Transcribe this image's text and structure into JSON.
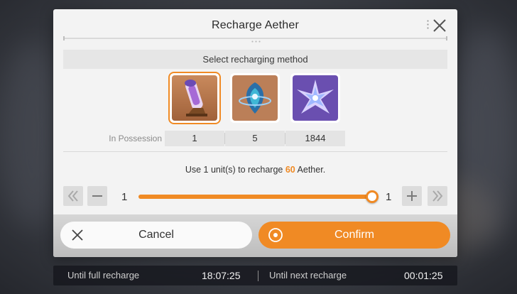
{
  "dialog": {
    "title": "Recharge Aether",
    "close_icon": "close-icon"
  },
  "method": {
    "heading": "Select recharging method",
    "items": [
      {
        "icon": "aether-vial-icon",
        "selected": true
      },
      {
        "icon": "aether-orb-icon",
        "selected": false
      },
      {
        "icon": "aether-crystal-icon",
        "selected": false
      }
    ]
  },
  "possession": {
    "label": "In Possession",
    "values": [
      "1",
      "5",
      "1844"
    ]
  },
  "recharge_info": {
    "prefix": "Use 1 unit(s) to recharge ",
    "amount": "60",
    "suffix": " Aether.",
    "amount_color": "#f08a24"
  },
  "quantity": {
    "min": "1",
    "max": "1",
    "fill_fraction": 1.0,
    "buttons": [
      "double-chevron-left-icon",
      "minus-icon",
      "plus-icon",
      "double-chevron-right-icon"
    ]
  },
  "actions": {
    "cancel_label": "Cancel",
    "confirm_label": "Confirm",
    "accent_color": "#f08a24"
  },
  "timers": {
    "full_label": "Until full recharge",
    "full_value": "18:07:25",
    "next_label": "Until next recharge",
    "next_value": "00:01:25"
  }
}
